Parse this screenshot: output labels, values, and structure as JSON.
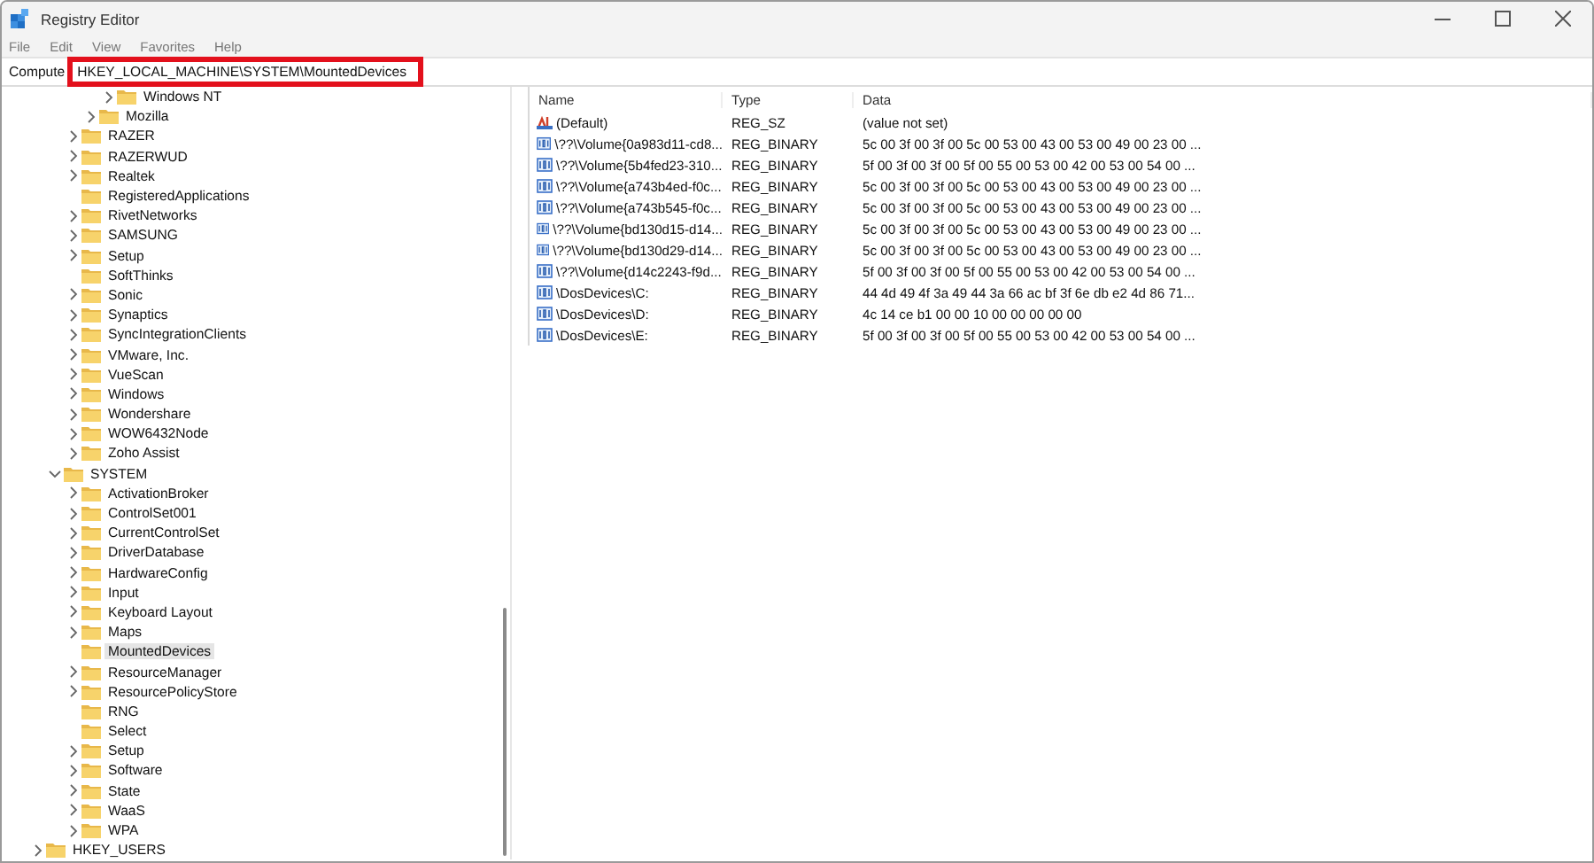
{
  "window": {
    "title": "Registry Editor"
  },
  "menu": [
    "File",
    "Edit",
    "View",
    "Favorites",
    "Help"
  ],
  "address": {
    "prefix": "Compute",
    "path": "HKEY_LOCAL_MACHINE\\SYSTEM\\MountedDevices",
    "highlighted": true
  },
  "tree": [
    {
      "children": [
        {
          "children": [
            {
              "children": [
                {
                  "children": [
                    {
                      "label": "Windows NT",
                      "expandable": true,
                      "expanded": false,
                      "selected": false
                    }
                  ]
                },
                {
                  "label": "Mozilla",
                  "expandable": true,
                  "expanded": false,
                  "selected": false
                }
              ]
            },
            {
              "label": "RAZER",
              "expandable": true,
              "expanded": false,
              "selected": false
            },
            {
              "label": "RAZERWUD",
              "expandable": true,
              "expanded": false,
              "selected": false
            },
            {
              "label": "Realtek",
              "expandable": true,
              "expanded": false,
              "selected": false
            },
            {
              "label": "RegisteredApplications",
              "expandable": false,
              "selected": false
            },
            {
              "label": "RivetNetworks",
              "expandable": true,
              "expanded": false,
              "selected": false
            },
            {
              "label": "SAMSUNG",
              "expandable": true,
              "expanded": false,
              "selected": false
            },
            {
              "label": "Setup",
              "expandable": true,
              "expanded": false,
              "selected": false
            },
            {
              "label": "SoftThinks",
              "expandable": false,
              "selected": false
            },
            {
              "label": "Sonic",
              "expandable": true,
              "expanded": false,
              "selected": false
            },
            {
              "label": "Synaptics",
              "expandable": true,
              "expanded": false,
              "selected": false
            },
            {
              "label": "SyncIntegrationClients",
              "expandable": true,
              "expanded": false,
              "selected": false
            },
            {
              "label": "VMware, Inc.",
              "expandable": true,
              "expanded": false,
              "selected": false
            },
            {
              "label": "VueScan",
              "expandable": true,
              "expanded": false,
              "selected": false
            },
            {
              "label": "Windows",
              "expandable": true,
              "expanded": false,
              "selected": false
            },
            {
              "label": "Wondershare",
              "expandable": true,
              "expanded": false,
              "selected": false
            },
            {
              "label": "WOW6432Node",
              "expandable": true,
              "expanded": false,
              "selected": false
            },
            {
              "label": "Zoho Assist",
              "expandable": true,
              "expanded": false,
              "selected": false
            }
          ]
        },
        {
          "label": "SYSTEM",
          "expandable": true,
          "expanded": true,
          "selected": false,
          "children": [
            {
              "label": "ActivationBroker",
              "expandable": true,
              "expanded": false,
              "selected": false
            },
            {
              "label": "ControlSet001",
              "expandable": true,
              "expanded": false,
              "selected": false
            },
            {
              "label": "CurrentControlSet",
              "expandable": true,
              "expanded": false,
              "selected": false
            },
            {
              "label": "DriverDatabase",
              "expandable": true,
              "expanded": false,
              "selected": false
            },
            {
              "label": "HardwareConfig",
              "expandable": true,
              "expanded": false,
              "selected": false
            },
            {
              "label": "Input",
              "expandable": true,
              "expanded": false,
              "selected": false
            },
            {
              "label": "Keyboard Layout",
              "expandable": true,
              "expanded": false,
              "selected": false
            },
            {
              "label": "Maps",
              "expandable": true,
              "expanded": false,
              "selected": false
            },
            {
              "label": "MountedDevices",
              "expandable": false,
              "selected": true
            },
            {
              "label": "ResourceManager",
              "expandable": true,
              "expanded": false,
              "selected": false
            },
            {
              "label": "ResourcePolicyStore",
              "expandable": true,
              "expanded": false,
              "selected": false
            },
            {
              "label": "RNG",
              "expandable": false,
              "selected": false
            },
            {
              "label": "Select",
              "expandable": false,
              "selected": false
            },
            {
              "label": "Setup",
              "expandable": true,
              "expanded": false,
              "selected": false
            },
            {
              "label": "Software",
              "expandable": true,
              "expanded": false,
              "selected": false
            },
            {
              "label": "State",
              "expandable": true,
              "expanded": false,
              "selected": false
            },
            {
              "label": "WaaS",
              "expandable": true,
              "expanded": false,
              "selected": false
            },
            {
              "label": "WPA",
              "expandable": true,
              "expanded": false,
              "selected": false
            }
          ]
        }
      ]
    },
    {
      "label": "HKEY_USERS",
      "expandable": true,
      "expanded": false,
      "selected": false
    }
  ],
  "table": {
    "columns": [
      "Name",
      "Type",
      "Data"
    ],
    "rows": [
      {
        "kind": "string",
        "name": "(Default)",
        "type": "REG_SZ",
        "data": "(value not set)"
      },
      {
        "kind": "binary",
        "name": "\\??\\Volume{0a983d11-cd8...",
        "type": "REG_BINARY",
        "data": "5c 00 3f 00 3f 00 5c 00 53 00 43 00 53 00 49 00 23 00 ..."
      },
      {
        "kind": "binary",
        "name": "\\??\\Volume{5b4fed23-310...",
        "type": "REG_BINARY",
        "data": "5f 00 3f 00 3f 00 5f 00 55 00 53 00 42 00 53 00 54 00 ..."
      },
      {
        "kind": "binary",
        "name": "\\??\\Volume{a743b4ed-f0c...",
        "type": "REG_BINARY",
        "data": "5c 00 3f 00 3f 00 5c 00 53 00 43 00 53 00 49 00 23 00 ..."
      },
      {
        "kind": "binary",
        "name": "\\??\\Volume{a743b545-f0c...",
        "type": "REG_BINARY",
        "data": "5c 00 3f 00 3f 00 5c 00 53 00 43 00 53 00 49 00 23 00 ..."
      },
      {
        "kind": "binary",
        "name": "\\??\\Volume{bd130d15-d14...",
        "type": "REG_BINARY",
        "data": "5c 00 3f 00 3f 00 5c 00 53 00 43 00 53 00 49 00 23 00 ..."
      },
      {
        "kind": "binary",
        "name": "\\??\\Volume{bd130d29-d14...",
        "type": "REG_BINARY",
        "data": "5c 00 3f 00 3f 00 5c 00 53 00 43 00 53 00 49 00 23 00 ..."
      },
      {
        "kind": "binary",
        "name": "\\??\\Volume{d14c2243-f9d...",
        "type": "REG_BINARY",
        "data": "5f 00 3f 00 3f 00 5f 00 55 00 53 00 42 00 53 00 54 00 ..."
      },
      {
        "kind": "binary",
        "name": "\\DosDevices\\C:",
        "type": "REG_BINARY",
        "data": "44 4d 49 4f 3a 49 44 3a 66 ac bf 3f 6e db e2 4d 86 71..."
      },
      {
        "kind": "binary",
        "name": "\\DosDevices\\D:",
        "type": "REG_BINARY",
        "data": "4c 14 ce b1 00 00 10 00 00 00 00 00"
      },
      {
        "kind": "binary",
        "name": "\\DosDevices\\E:",
        "type": "REG_BINARY",
        "data": "5f 00 3f 00 3f 00 5f 00 55 00 53 00 42 00 53 00 54 00 ..."
      }
    ]
  }
}
